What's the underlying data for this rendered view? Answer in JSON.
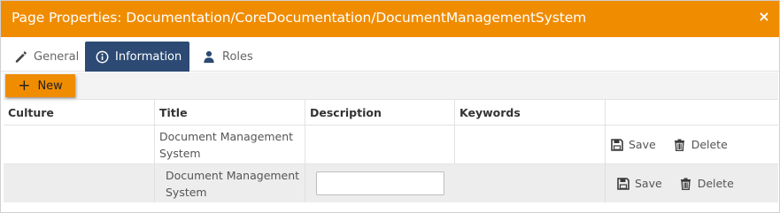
{
  "dialog": {
    "title": "Page Properties: Documentation/CoreDocumentation/DocumentManagementSystem",
    "close_icon": "×",
    "accent_color": "#f08c00",
    "active_tab_color": "#2c4a73"
  },
  "tabs": [
    {
      "label": "General",
      "icon": "pencil-icon"
    },
    {
      "label": "Information",
      "icon": "info-circle-icon",
      "active": true
    },
    {
      "label": "Roles",
      "icon": "user-icon"
    }
  ],
  "toolbar": {
    "new_label": "New",
    "new_icon": "+"
  },
  "grid": {
    "columns": [
      "Culture",
      "Title",
      "Description",
      "Keywords",
      ""
    ],
    "rows": [
      {
        "culture": "",
        "title": "Document Management System",
        "description": "",
        "keywords": "",
        "save_label": "Save",
        "delete_label": "Delete"
      },
      {
        "culture": "",
        "title": "Document Management System",
        "description": "",
        "keywords": "",
        "save_label": "Save",
        "delete_label": "Delete",
        "editing": true
      }
    ]
  }
}
